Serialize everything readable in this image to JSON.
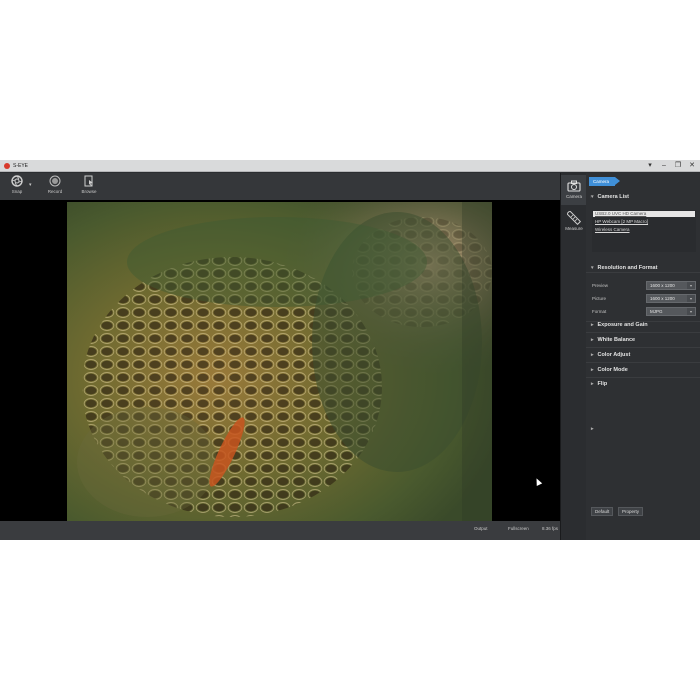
{
  "window": {
    "title": "S-EYE"
  },
  "toolbar": [
    {
      "label": "Snap",
      "icon": "aperture-icon"
    },
    {
      "label": "Record",
      "icon": "record-icon"
    },
    {
      "label": "Browse",
      "icon": "browse-icon"
    }
  ],
  "sidetabs": [
    {
      "label": "Camera",
      "icon": "camera-icon"
    },
    {
      "label": "Measure",
      "icon": "ruler-icon"
    }
  ],
  "panel": {
    "tag": "Camera",
    "camera_list": {
      "title": "Camera List",
      "items": [
        "USB2.0 UVC HD Camera",
        "HP Webcam [2 MP Macro]",
        "Wireless Camera"
      ],
      "selected_index": 0
    },
    "resolution": {
      "title": "Resolution and Format",
      "rows": [
        {
          "label": "Preview",
          "value": "1600 x 1200"
        },
        {
          "label": "Picture",
          "value": "1600 x 1200"
        },
        {
          "label": "Format",
          "value": "MJPG"
        }
      ]
    },
    "sections": [
      "Exposure and Gain",
      "White Balance",
      "Color Adjust",
      "Color Mode",
      "Flip"
    ],
    "buttons": {
      "default": "Default",
      "property": "Property"
    }
  },
  "status": {
    "output": "Output",
    "fullscreen": "Fullscreen",
    "fps": "8.36 fps"
  },
  "colors": {
    "accent": "#3f8fd8",
    "logo": "#d83a2c",
    "app_bg": "#2b2d30"
  }
}
